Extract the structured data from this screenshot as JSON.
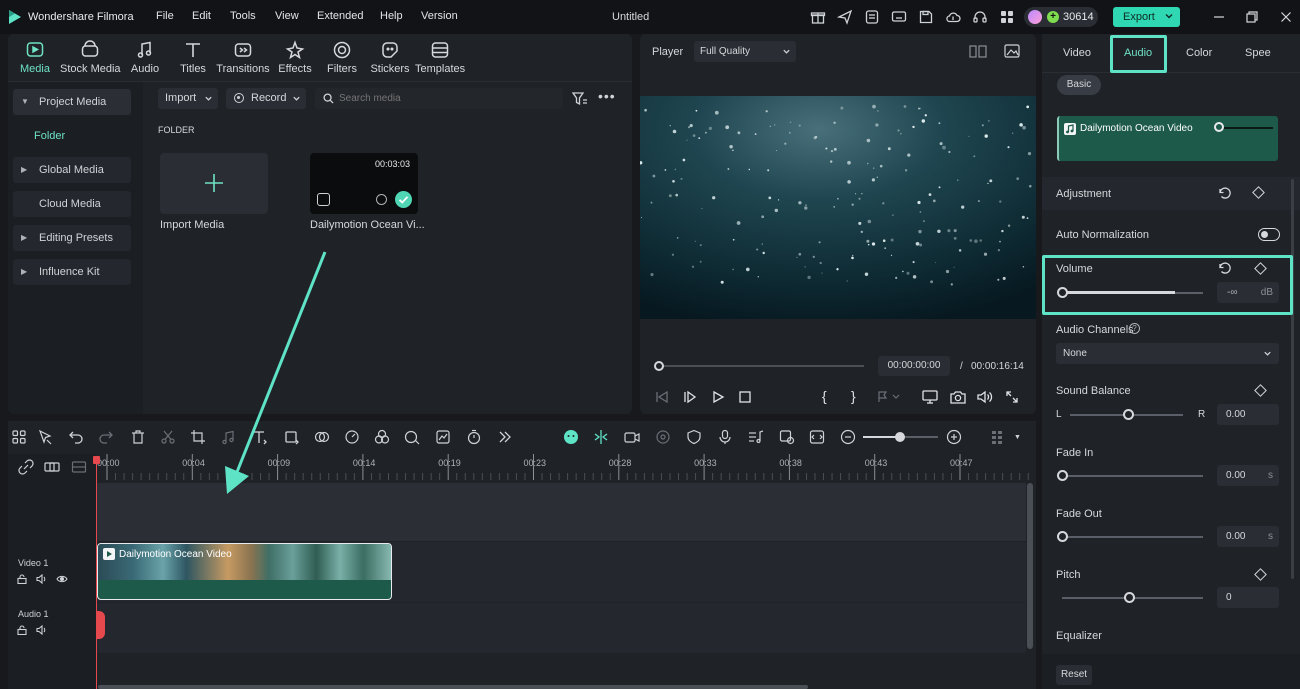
{
  "app": {
    "name": "Wondershare Filmora",
    "project_title": "Untitled",
    "credits": "30614",
    "export_label": "Export"
  },
  "menu": [
    "File",
    "Edit",
    "Tools",
    "View",
    "Extended",
    "Help",
    "Version"
  ],
  "media_tabs": [
    {
      "label": "Media",
      "icon": "media-icon",
      "active": true
    },
    {
      "label": "Stock Media",
      "icon": "stock-media-icon"
    },
    {
      "label": "Audio",
      "icon": "music-note-icon"
    },
    {
      "label": "Titles",
      "icon": "titles-icon"
    },
    {
      "label": "Transitions",
      "icon": "transitions-icon"
    },
    {
      "label": "Effects",
      "icon": "effects-icon"
    },
    {
      "label": "Filters",
      "icon": "filters-icon"
    },
    {
      "label": "Stickers",
      "icon": "stickers-icon"
    },
    {
      "label": "Templates",
      "icon": "templates-icon"
    }
  ],
  "sidebar": {
    "items": [
      {
        "label": "Project Media",
        "expandable": true,
        "expanded": true
      },
      {
        "label": "Global Media",
        "expandable": true
      },
      {
        "label": "Cloud Media",
        "expandable": false
      },
      {
        "label": "Editing Presets",
        "expandable": true
      },
      {
        "label": "Influence Kit",
        "expandable": true
      }
    ],
    "folder_label": "Folder"
  },
  "media_toolbar": {
    "import_label": "Import",
    "record_label": "Record",
    "search_placeholder": "Search media"
  },
  "media_area": {
    "section_label": "FOLDER",
    "import_card_label": "Import Media",
    "clip": {
      "name": "Dailymotion Ocean Vi...",
      "duration": "00:03:03"
    }
  },
  "player": {
    "label": "Player",
    "quality": "Full Quality",
    "current_time": "00:00:00:00",
    "separator": "/",
    "total_time": "00:00:16:14"
  },
  "right_panel": {
    "tabs": [
      "Video",
      "Audio",
      "Color",
      "Spee"
    ],
    "active_tab": "Audio",
    "sub_tab": "Basic",
    "clip_name": "Dailymotion Ocean Video",
    "adjustment_label": "Adjustment",
    "auto_normalization_label": "Auto Normalization",
    "auto_normalization_on": false,
    "volume": {
      "label": "Volume",
      "value": "-∞",
      "unit": "dB"
    },
    "audio_channels": {
      "label": "Audio Channels",
      "value": "None"
    },
    "sound_balance": {
      "label": "Sound Balance",
      "left": "L",
      "right": "R",
      "value": "0.00"
    },
    "fade_in": {
      "label": "Fade In",
      "value": "0.00",
      "unit": "s"
    },
    "fade_out": {
      "label": "Fade Out",
      "value": "0.00",
      "unit": "s"
    },
    "pitch": {
      "label": "Pitch",
      "value": "0"
    },
    "equalizer_label": "Equalizer",
    "reset_label": "Reset"
  },
  "timeline": {
    "ruler": [
      "00:00",
      "00:04",
      "00:09",
      "00:14",
      "00:19",
      "00:23",
      "00:28",
      "00:33",
      "00:38",
      "00:43",
      "00:47"
    ],
    "tracks": [
      {
        "label": "Video 1"
      },
      {
        "label": "Audio 1"
      }
    ],
    "video_clip_label": "Dailymotion Ocean Video"
  },
  "colors": {
    "accent": "#5ee3c6",
    "export_button": "#2fd8b2",
    "clip_teal": "#1d5a4a",
    "playhead": "#e5484d"
  }
}
